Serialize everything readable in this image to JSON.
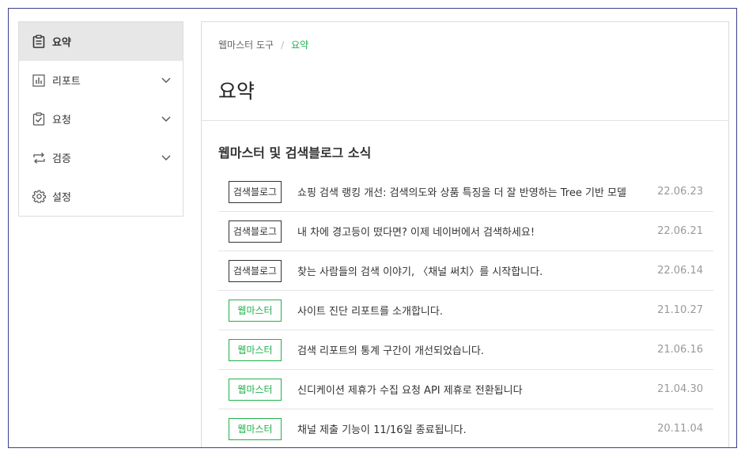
{
  "sidebar": {
    "items": [
      {
        "label": "요약",
        "icon": "clipboard-icon"
      },
      {
        "label": "리포트",
        "icon": "bar-chart-icon"
      },
      {
        "label": "요청",
        "icon": "checkbox-clipboard-icon"
      },
      {
        "label": "검증",
        "icon": "repeat-arrows-icon"
      },
      {
        "label": "설정",
        "icon": "gear-icon"
      }
    ]
  },
  "breadcrumb": {
    "root": "웹마스터 도구",
    "separator": "/",
    "current": "요약"
  },
  "page": {
    "title": "요약",
    "section_title": "웹마스터 및 검색블로그 소식"
  },
  "news": [
    {
      "badge": "검색블로그",
      "title": "쇼핑 검색 랭킹 개선: 검색의도와 상품 특징을 더 잘 반영하는 Tree 기반 모델",
      "date": "22.06.23"
    },
    {
      "badge": "검색블로그",
      "title": "내 차에 경고등이 떴다면? 이제 네이버에서 검색하세요!",
      "date": "22.06.21"
    },
    {
      "badge": "검색블로그",
      "title": "찾는 사람들의 검색 이야기, 〈채널 써치〉를 시작합니다.",
      "date": "22.06.14"
    },
    {
      "badge": "웹마스터",
      "title": "사이트 진단 리포트를 소개합니다.",
      "date": "21.10.27"
    },
    {
      "badge": "웹마스터",
      "title": "검색 리포트의 통계 구간이 개선되었습니다.",
      "date": "21.06.16"
    },
    {
      "badge": "웹마스터",
      "title": "신디케이션 제휴가 수집 요청 API 제휴로 전환됩니다",
      "date": "21.04.30"
    },
    {
      "badge": "웹마스터",
      "title": "채널 제출 기능이 11/16일 종료됩니다.",
      "date": "20.11.04"
    }
  ],
  "colors": {
    "accent_green": "#22b04b",
    "frame_border": "#3d3f8a"
  }
}
